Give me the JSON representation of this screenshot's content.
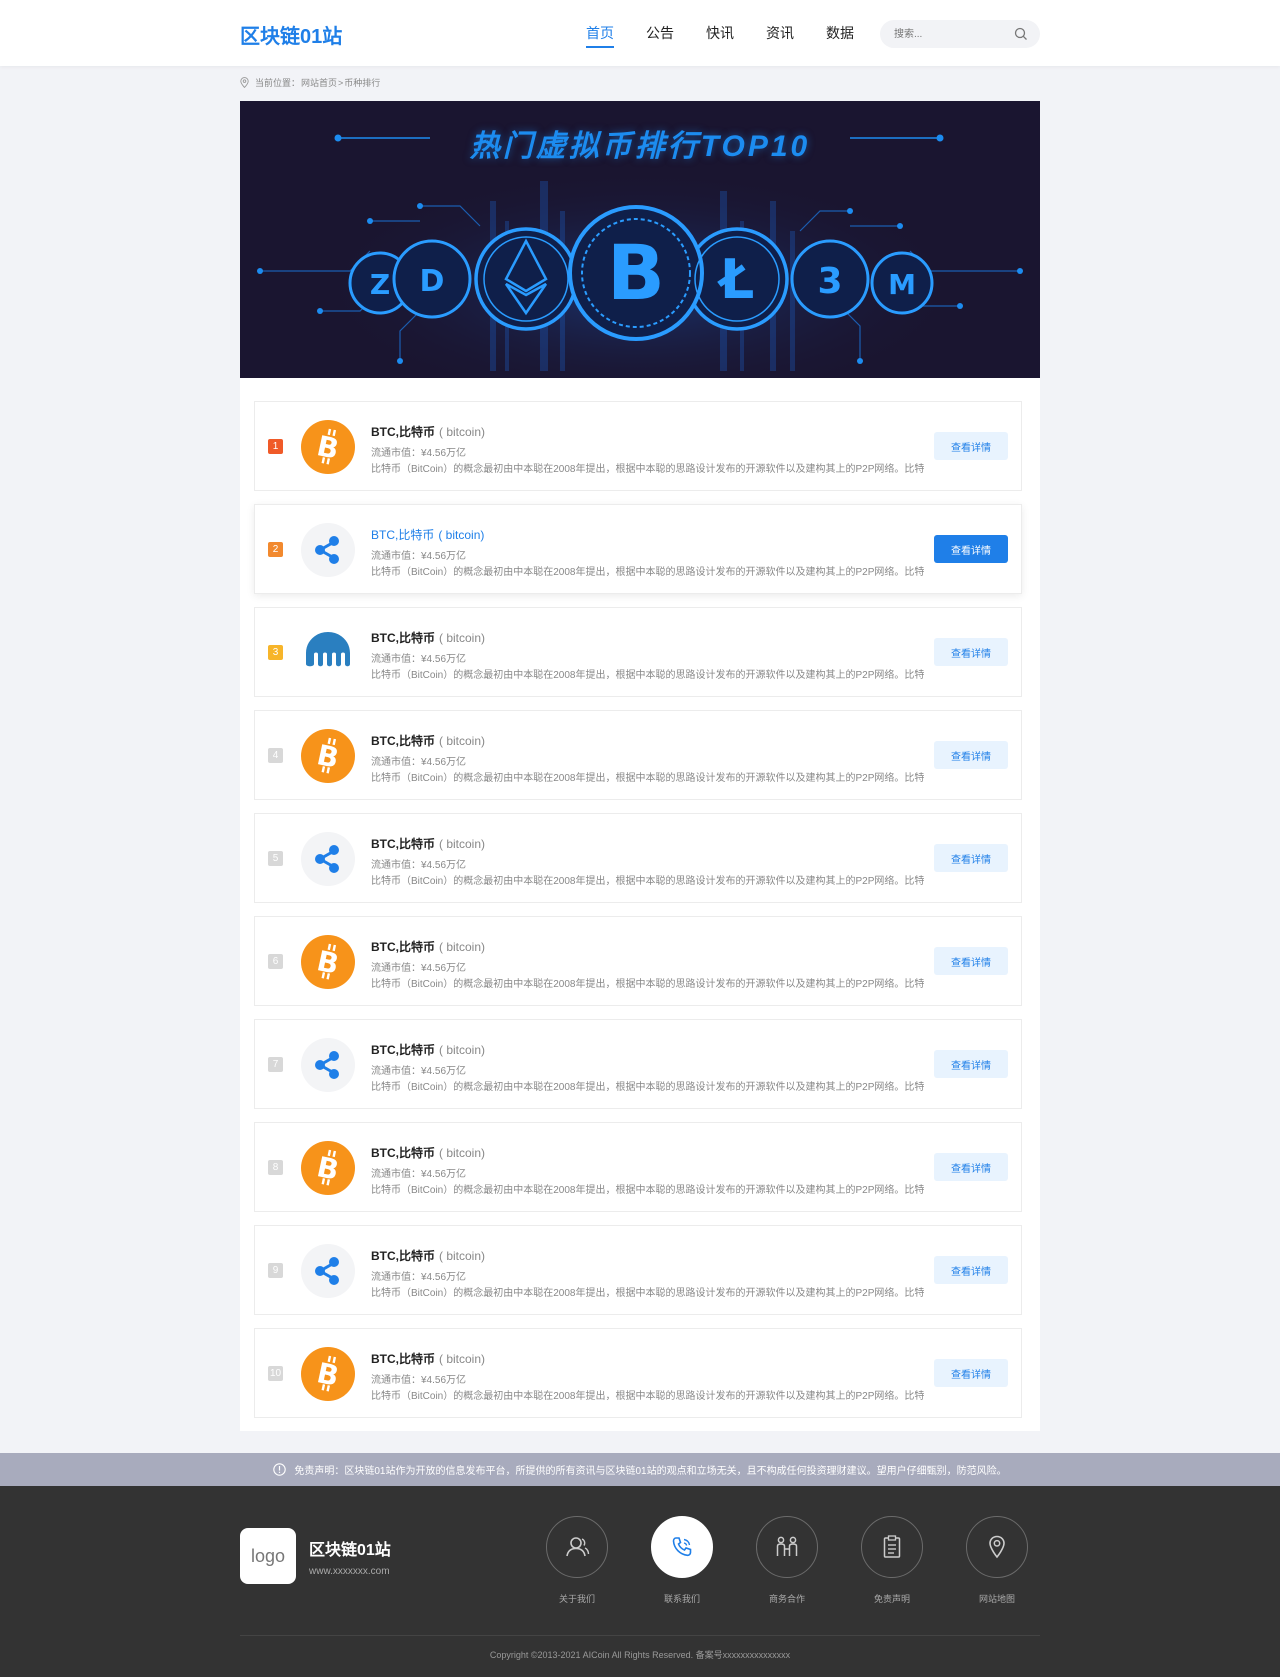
{
  "header": {
    "brand": "区块链01站",
    "nav": [
      {
        "label": "首页",
        "active": true
      },
      {
        "label": "公告",
        "active": false
      },
      {
        "label": "快讯",
        "active": false
      },
      {
        "label": "资讯",
        "active": false
      },
      {
        "label": "数据",
        "active": false
      }
    ],
    "search_placeholder": "搜索...",
    "search_icon": "search-icon"
  },
  "breadcrumb": {
    "prefix": "当前位置：",
    "home": "网站首页",
    "sep": ">",
    "current": "币种排行"
  },
  "banner": {
    "title": "热门虚拟币排行TOP10",
    "coins": [
      "zcash",
      "dash",
      "ethereum",
      "bitcoin",
      "litecoin",
      "ripple",
      "monero"
    ]
  },
  "coins": [
    {
      "rank": "1",
      "icon": "bitcoin-icon",
      "name": "BTC,比特币",
      "sub": "( bitcoin)",
      "mcap": "流通市值：¥4.56万亿",
      "desc": "比特币（BitCoin）的概念最初由中本聪在2008年提出，根据中本聪的思路设计发布的开源软件以及建构其上的P2P网络。比特",
      "button": "查看详情"
    },
    {
      "rank": "2",
      "icon": "ripple-icon",
      "name": "BTC,比特币",
      "sub": "( bitcoin)",
      "mcap": "流通市值：¥4.56万亿",
      "desc": "比特币（BitCoin）的概念最初由中本聪在2008年提出，根据中本聪的思路设计发布的开源软件以及建构其上的P2P网络。比特",
      "button": "查看详情",
      "hover": true
    },
    {
      "rank": "3",
      "icon": "kraken-icon",
      "name": "BTC,比特币",
      "sub": "( bitcoin)",
      "mcap": "流通市值：¥4.56万亿",
      "desc": "比特币（BitCoin）的概念最初由中本聪在2008年提出，根据中本聪的思路设计发布的开源软件以及建构其上的P2P网络。比特",
      "button": "查看详情"
    },
    {
      "rank": "4",
      "icon": "bitcoin-icon",
      "name": "BTC,比特币",
      "sub": "( bitcoin)",
      "mcap": "流通市值：¥4.56万亿",
      "desc": "比特币（BitCoin）的概念最初由中本聪在2008年提出，根据中本聪的思路设计发布的开源软件以及建构其上的P2P网络。比特",
      "button": "查看详情"
    },
    {
      "rank": "5",
      "icon": "ripple-icon",
      "name": "BTC,比特币",
      "sub": "( bitcoin)",
      "mcap": "流通市值：¥4.56万亿",
      "desc": "比特币（BitCoin）的概念最初由中本聪在2008年提出，根据中本聪的思路设计发布的开源软件以及建构其上的P2P网络。比特",
      "button": "查看详情"
    },
    {
      "rank": "6",
      "icon": "bitcoin-icon",
      "name": "BTC,比特币",
      "sub": "( bitcoin)",
      "mcap": "流通市值：¥4.56万亿",
      "desc": "比特币（BitCoin）的概念最初由中本聪在2008年提出，根据中本聪的思路设计发布的开源软件以及建构其上的P2P网络。比特",
      "button": "查看详情"
    },
    {
      "rank": "7",
      "icon": "ripple-icon",
      "name": "BTC,比特币",
      "sub": "( bitcoin)",
      "mcap": "流通市值：¥4.56万亿",
      "desc": "比特币（BitCoin）的概念最初由中本聪在2008年提出，根据中本聪的思路设计发布的开源软件以及建构其上的P2P网络。比特",
      "button": "查看详情"
    },
    {
      "rank": "8",
      "icon": "bitcoin-icon",
      "name": "BTC,比特币",
      "sub": "( bitcoin)",
      "mcap": "流通市值：¥4.56万亿",
      "desc": "比特币（BitCoin）的概念最初由中本聪在2008年提出，根据中本聪的思路设计发布的开源软件以及建构其上的P2P网络。比特",
      "button": "查看详情"
    },
    {
      "rank": "9",
      "icon": "ripple-icon",
      "name": "BTC,比特币",
      "sub": "( bitcoin)",
      "mcap": "流通市值：¥4.56万亿",
      "desc": "比特币（BitCoin）的概念最初由中本聪在2008年提出，根据中本聪的思路设计发布的开源软件以及建构其上的P2P网络。比特",
      "button": "查看详情"
    },
    {
      "rank": "10",
      "icon": "bitcoin-icon",
      "name": "BTC,比特币",
      "sub": "( bitcoin)",
      "mcap": "流通市值：¥4.56万亿",
      "desc": "比特币（BitCoin）的概念最初由中本聪在2008年提出，根据中本聪的思路设计发布的开源软件以及建构其上的P2P网络。比特",
      "button": "查看详情"
    }
  ],
  "disclaimer": "免责声明：区块链01站作为开放的信息发布平台，所提供的所有资讯与区块链01站的观点和立场无关，且不构成任何投资理财建议。望用户仔细甄别，防范风险。",
  "footer": {
    "logo_text": "logo",
    "brand": "区块链01站",
    "url": "www.xxxxxxx.com",
    "links": [
      {
        "label": "关于我们",
        "icon": "user-icon"
      },
      {
        "label": "联系我们",
        "icon": "phone-icon",
        "active": true
      },
      {
        "label": "商务合作",
        "icon": "partners-icon"
      },
      {
        "label": "免责声明",
        "icon": "clipboard-icon"
      },
      {
        "label": "网站地图",
        "icon": "map-pin-icon"
      }
    ],
    "copyright": "Copyright ©2013-2021 AICoin All Rights Reserved. 备案号xxxxxxxxxxxxxxx"
  },
  "colors": {
    "accent": "#1f7fe8",
    "bitcoin": "#f7931a",
    "rank1": "#f05a28",
    "rank2": "#f2892e",
    "rank3": "#f7b52a",
    "footer_bg": "#333333",
    "banner_bg": "#1a1530"
  }
}
